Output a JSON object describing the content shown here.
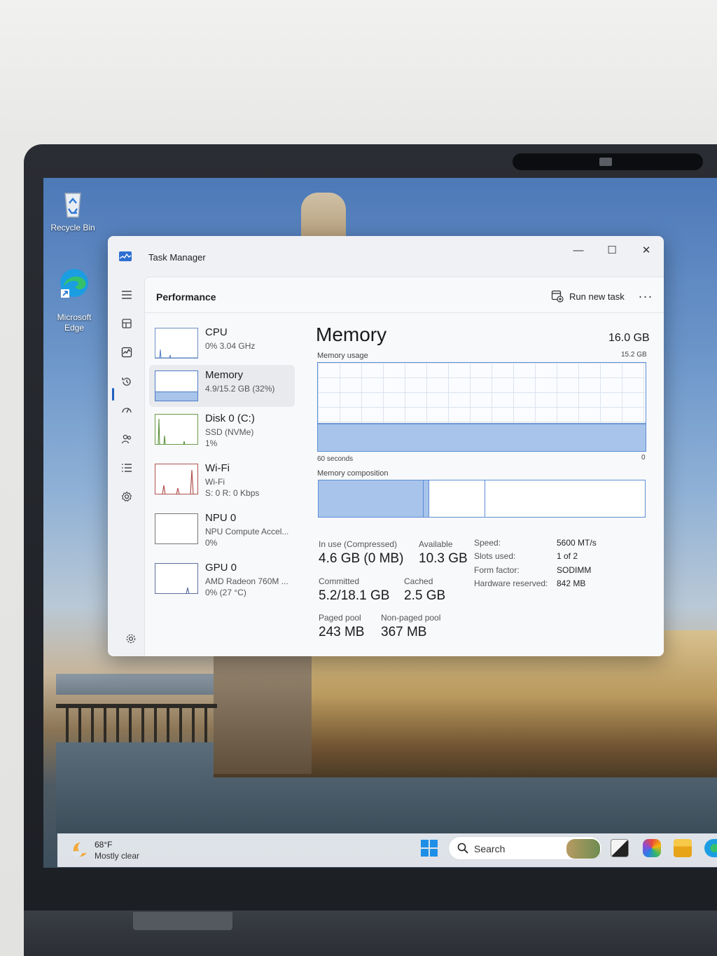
{
  "desktop": {
    "icons": [
      {
        "label": "Recycle Bin",
        "icon": "recycle-bin-icon"
      },
      {
        "label": "Microsoft\nEdge",
        "icon": "edge-icon"
      }
    ]
  },
  "task_manager": {
    "title": "Task Manager",
    "window_buttons": {
      "minimize": "—",
      "maximize": "☐",
      "close": "✕"
    },
    "header": {
      "title": "Performance",
      "run_new_task": "Run new task",
      "more": "···"
    },
    "nav": [
      "hamburger-menu-icon",
      "processes-icon",
      "performance-icon",
      "app-history-icon",
      "startup-apps-icon",
      "users-icon",
      "details-icon",
      "services-icon",
      "settings-icon"
    ],
    "devices": [
      {
        "name": "CPU",
        "sub1": "0%  3.04 GHz",
        "sub2": ""
      },
      {
        "name": "Memory",
        "sub1": "4.9/15.2 GB (32%)",
        "sub2": ""
      },
      {
        "name": "Disk 0 (C:)",
        "sub1": "SSD (NVMe)",
        "sub2": "1%"
      },
      {
        "name": "Wi-Fi",
        "sub1": "Wi-Fi",
        "sub2": "S: 0  R: 0 Kbps"
      },
      {
        "name": "NPU 0",
        "sub1": "NPU Compute Accel...",
        "sub2": "0%"
      },
      {
        "name": "GPU 0",
        "sub1": "AMD Radeon 760M ...",
        "sub2": "0%  (27 °C)"
      }
    ],
    "memory": {
      "title": "Memory",
      "total": "16.0 GB",
      "usage_label": "Memory usage",
      "usage_max": "15.2 GB",
      "usage_level": 0.32,
      "seconds_label": "60 seconds",
      "zero_label": "0",
      "composition_label": "Memory composition",
      "composition": {
        "in_use_fraction": 0.32,
        "modified_fraction": 0.02,
        "standby_fraction": 0.17,
        "free_fraction": 0.49
      },
      "stats": {
        "in_use_label": "In use (Compressed)",
        "in_use_value": "4.6 GB (0 MB)",
        "available_label": "Available",
        "available_value": "10.3 GB",
        "committed_label": "Committed",
        "committed_value": "5.2/18.1 GB",
        "cached_label": "Cached",
        "cached_value": "2.5 GB",
        "paged_pool_label": "Paged pool",
        "paged_pool_value": "243 MB",
        "non_paged_pool_label": "Non-paged pool",
        "non_paged_pool_value": "367 MB"
      },
      "details": [
        {
          "key": "Speed:",
          "value": "5600 MT/s"
        },
        {
          "key": "Slots used:",
          "value": "1 of 2"
        },
        {
          "key": "Form factor:",
          "value": "SODIMM"
        },
        {
          "key": "Hardware reserved:",
          "value": "842 MB"
        }
      ]
    }
  },
  "taskbar": {
    "weather": {
      "temp": "68°F",
      "condition": "Mostly clear"
    },
    "search_placeholder": "Search"
  },
  "colors": {
    "accent": "#1f5fbf",
    "memory_fill": "#a8c4ea",
    "memory_line": "#5b8ed6"
  }
}
